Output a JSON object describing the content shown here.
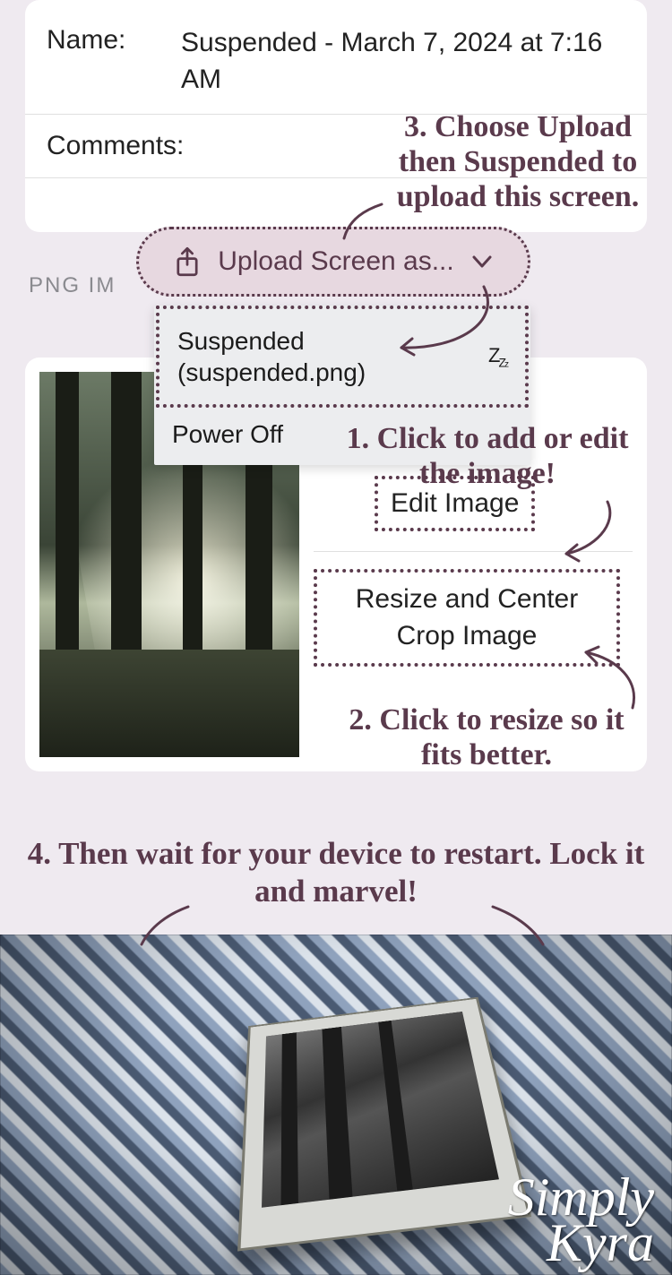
{
  "top_card": {
    "name_label": "Name:",
    "name_value": "Suspended - March 7, 2024 at 7:16 AM",
    "comments_label": "Comments:"
  },
  "upload": {
    "button_label": "Upload Screen as...",
    "menu_item_1_line1": "Suspended",
    "menu_item_1_line2": "(suspended.png)",
    "menu_item_2": "Power Off"
  },
  "section_header": "PNG IM",
  "image_card": {
    "edit_label": "Edit Image",
    "resize_label": "Resize and Center Crop Image"
  },
  "annotations": {
    "a1": "1. Click to add or edit the image!",
    "a2": "2. Click to resize so it fits better.",
    "a3": "3. Choose Upload then Suspended to upload this screen.",
    "a4": "4. Then wait for your device to restart. Lock it and marvel!"
  },
  "icons": {
    "share": "share-icon",
    "chevron": "chevron-down-icon",
    "sleep": "zz"
  },
  "watermark": {
    "line1": "Simply",
    "line2": "Kyra"
  },
  "colors": {
    "accent": "#5a3a4c"
  }
}
